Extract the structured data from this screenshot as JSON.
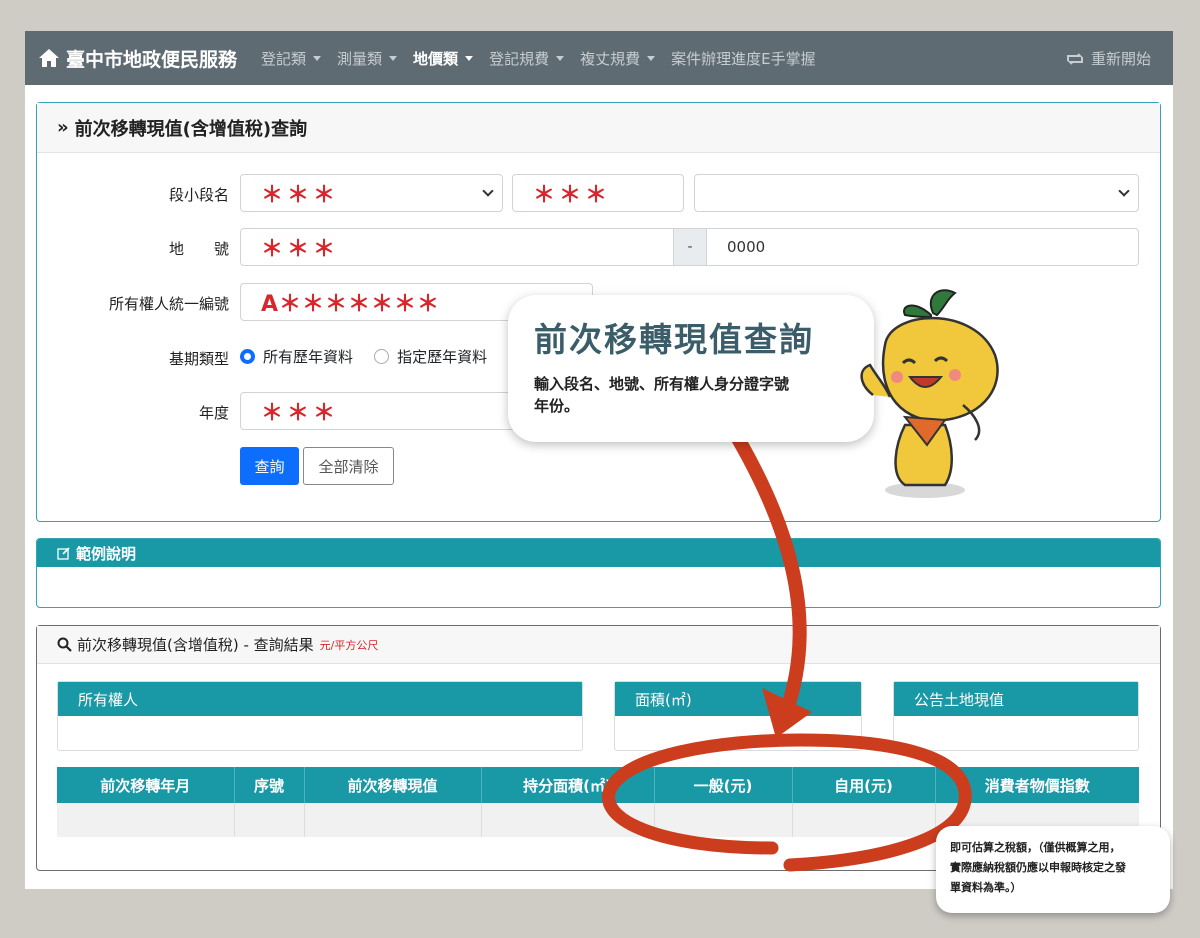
{
  "navbar": {
    "brand": "臺中市地政便民服務",
    "items": [
      {
        "label": "登記類",
        "active": false
      },
      {
        "label": "測量類",
        "active": false
      },
      {
        "label": "地價類",
        "active": true
      },
      {
        "label": "登記規費",
        "active": false
      },
      {
        "label": "複丈規費",
        "active": false
      },
      {
        "label": "案件辦理進度E手掌握",
        "active": false
      }
    ],
    "restart": "重新開始"
  },
  "query_card": {
    "title": "前次移轉現值(含增值稅)查詢",
    "section_label": "段小段名",
    "section_value": "＊＊＊",
    "subsection_value": "＊＊＊",
    "land_no_label": "地　　號",
    "land_no_value": "＊＊＊",
    "land_no_sep": "-",
    "land_no_suffix": "0000",
    "owner_id_label": "所有權人統一編號",
    "owner_id_value": "A＊＊＊＊＊＊＊",
    "period_label": "基期類型",
    "period_options": [
      "所有歷年資料",
      "指定歷年資料"
    ],
    "year_label": "年度",
    "year_value": "＊＊＊",
    "query_button": "查詢",
    "clear_button": "全部清除"
  },
  "example_card": {
    "title": "範例說明"
  },
  "result_card": {
    "title": "前次移轉現值(含增值稅) - 查詢結果",
    "unit": "元/平方公尺",
    "owner_header": "所有權人",
    "area_header": "面積(㎡)",
    "land_value_header": "公告土地現值",
    "table_headers": [
      "前次移轉年月",
      "序號",
      "前次移轉現值",
      "持分面積(㎡)",
      "一般(元)",
      "自用(元)",
      "消費者物價指數"
    ]
  },
  "callout": {
    "title": "前次移轉現值查詢",
    "text_line1": "輸入段名、地號、所有權人身分證字號",
    "text_line2": "年份。"
  },
  "note": {
    "line1": "即可估算之稅額，（僅供概算之用，",
    "line2": "實際應納稅額仍應以申報時核定之發",
    "line3": "單資料為準。）"
  },
  "colors": {
    "navbar": "#5f6b72",
    "teal": "#1998a6",
    "primary": "#0d6efd",
    "red_mask": "#d9262c",
    "arrow": "#cc3d1e"
  }
}
